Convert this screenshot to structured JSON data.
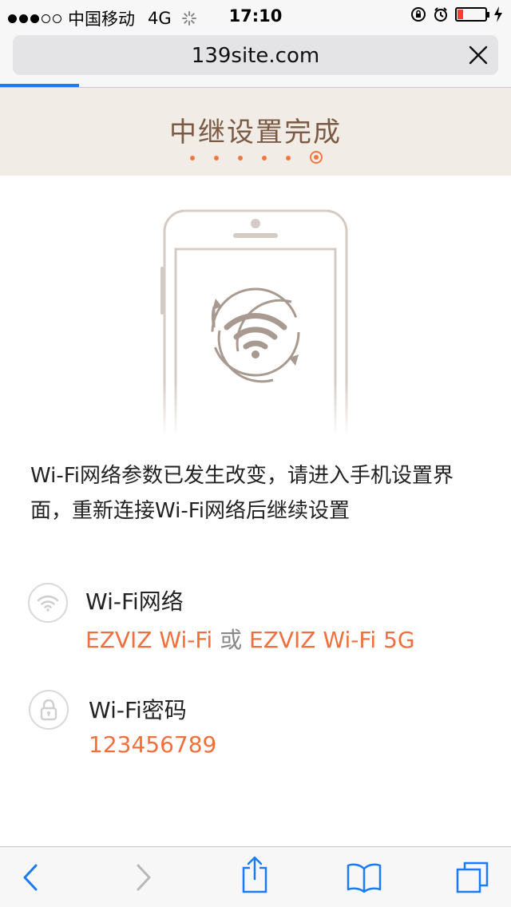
{
  "status_bar": {
    "carrier": "中国移动",
    "network": "4G",
    "time": "17:10"
  },
  "address_bar": {
    "url": "139site.com"
  },
  "header": {
    "title": "中继设置完成",
    "total_steps": 6,
    "current_step": 6
  },
  "message": "Wi-Fi网络参数已发生改变，请进入手机设置界面，重新连接Wi-Fi网络后继续设置",
  "wifi_network": {
    "label": "Wi-Fi网络",
    "ssid_1": "EZVIZ Wi-Fi",
    "separator": "或",
    "ssid_2": "EZVIZ Wi-Fi 5G"
  },
  "wifi_password": {
    "label": "Wi-Fi密码",
    "value": "123456789"
  },
  "colors": {
    "accent": "#f06f3c",
    "header_bg": "#f2ece6",
    "title": "#7a5a45",
    "ios_blue": "#1a7cf5"
  }
}
